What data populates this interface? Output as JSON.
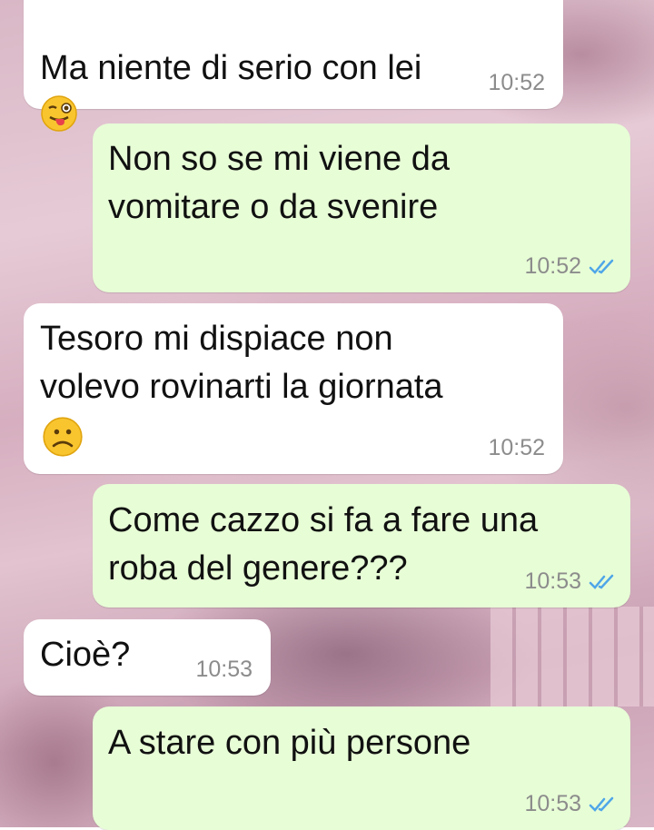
{
  "messages": [
    {
      "direction": "in",
      "text": "Ma niente di serio con lei",
      "emoji": "winking-tongue-face",
      "time": "10:52"
    },
    {
      "direction": "out",
      "text": "Non so se mi viene da\nvomitare o da svenire",
      "time": "10:52",
      "read": true
    },
    {
      "direction": "in",
      "text": "Tesoro mi dispiace non\nvolevo rovinarti la giornata",
      "emoji": "frowning-face",
      "time": "10:52"
    },
    {
      "direction": "out",
      "text": "Come cazzo si fa a fare una\nroba del genere???",
      "time": "10:53",
      "read": true
    },
    {
      "direction": "in",
      "text": "Cioè?",
      "time": "10:53"
    },
    {
      "direction": "out",
      "text": "A stare con più persone",
      "time": "10:53",
      "read": true
    }
  ],
  "colors": {
    "incoming_bubble": "#ffffff",
    "outgoing_bubble": "#e7fdd6",
    "read_ticks": "#4fa6e8",
    "timestamp": "#8c8c8c"
  }
}
